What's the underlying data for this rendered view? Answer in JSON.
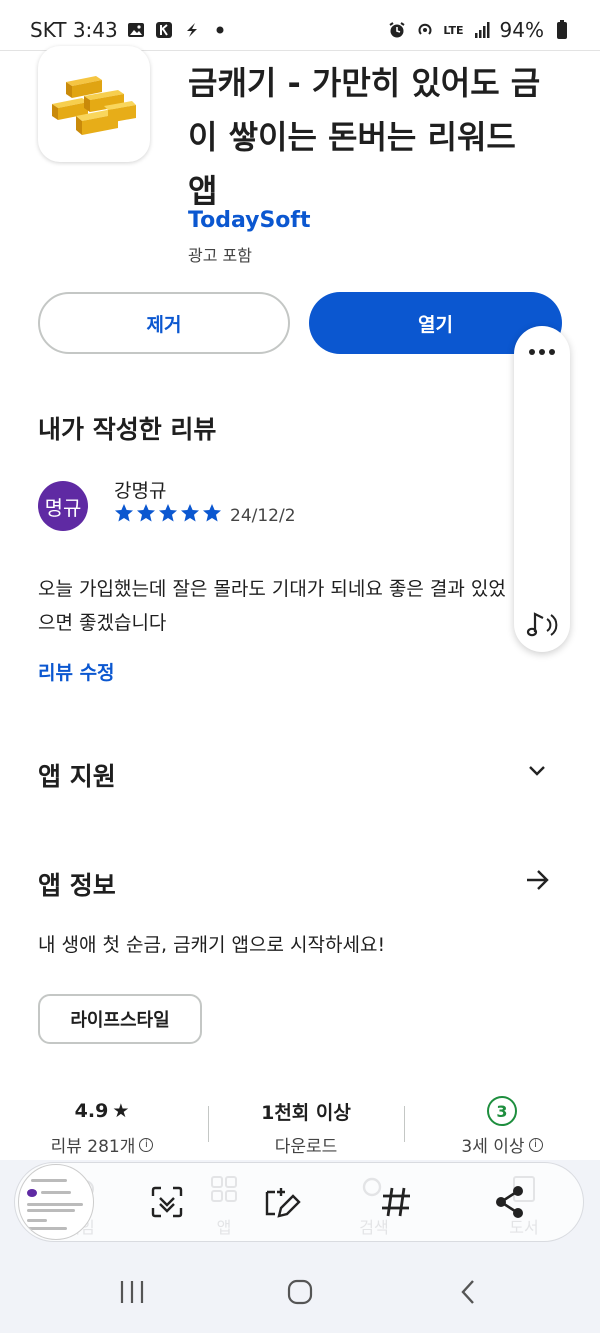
{
  "status_bar": {
    "carrier_time": "SKT 3:43",
    "network": "LTE",
    "battery": "94%"
  },
  "app": {
    "title": "금캐기 - 가만히 있어도 금이 쌓이는 돈버는 리워드 앱",
    "developer": "TodaySoft",
    "ads_note": "광고 포함",
    "icon": "gold-bars-icon"
  },
  "actions": {
    "remove_label": "제거",
    "open_label": "열기"
  },
  "my_review": {
    "section_title": "내가 작성한 리뷰",
    "avatar_text": "명규",
    "reviewer": "강명규",
    "rating": 5,
    "date": "24/12/2",
    "text": "오늘 가입했는데 잘은 몰라도 기대가 되네요 좋은 결과 있었으면 좋겠습니다",
    "edit_label": "리뷰 수정"
  },
  "app_support": {
    "title": "앱 지원"
  },
  "app_info": {
    "title": "앱 정보",
    "description": "내 생애 첫 순금, 금캐기 앱으로 시작하세요!",
    "category_chip": "라이프스타일"
  },
  "stats": {
    "rating_value": "4.9",
    "rating_label": "리뷰 281개",
    "downloads_value": "1천회 이상",
    "downloads_label": "다운로드",
    "age_value": "3",
    "age_label": "3세 이상"
  },
  "bottom_nav": {
    "items": [
      {
        "label": "게임",
        "icon": "gamepad-icon"
      },
      {
        "label": "앱",
        "icon": "apps-grid-icon"
      },
      {
        "label": "검색",
        "icon": "search-icon"
      },
      {
        "label": "도서",
        "icon": "book-icon"
      }
    ]
  },
  "colors": {
    "accent": "#0b57d0",
    "avatar": "#5f2aa3",
    "age_badge": "#1e8e3e"
  }
}
